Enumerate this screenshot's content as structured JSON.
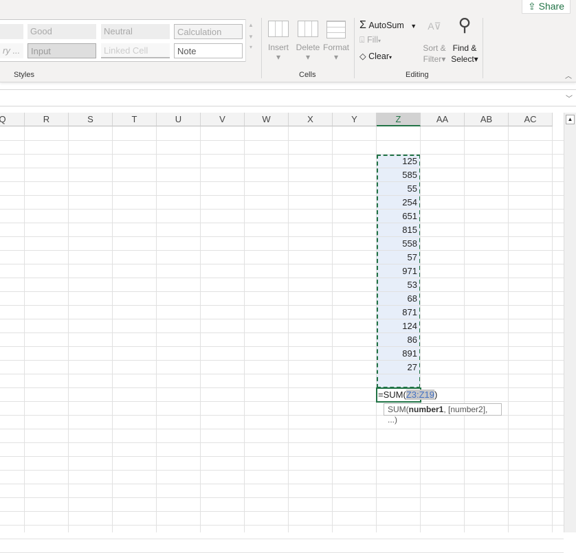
{
  "share_label": "Share",
  "styles": {
    "group_label": "Styles",
    "items": [
      {
        "label": "Good",
        "bg": "#ededed"
      },
      {
        "label": "Neutral",
        "bg": "#ededed"
      },
      {
        "label": "Calculation",
        "bg": "#f3f3f3"
      },
      {
        "label": "ry ...",
        "bg": "#f7f7f7"
      },
      {
        "label": "Input",
        "bg": "#dedede"
      },
      {
        "label": "Linked Cell",
        "bg": "#f3f3f3"
      },
      {
        "label": "Note",
        "bg": "#f7f7f7"
      }
    ]
  },
  "cells": {
    "group_label": "Cells",
    "insert": "Insert",
    "delete": "Delete",
    "format": "Format"
  },
  "editing": {
    "group_label": "Editing",
    "autosum": "AutoSum",
    "fill": "Fill",
    "clear": "Clear",
    "sort1": "Sort &",
    "sort2": "Filter",
    "find1": "Find &",
    "find2": "Select"
  },
  "columns": [
    "Q",
    "R",
    "S",
    "T",
    "U",
    "V",
    "W",
    "X",
    "Y",
    "Z",
    "AA",
    "AB",
    "AC"
  ],
  "selected_column": "Z",
  "values": [
    "125",
    "585",
    "55",
    "254",
    "651",
    "815",
    "558",
    "57",
    "971",
    "53",
    "68",
    "871",
    "124",
    "86",
    "891",
    "27"
  ],
  "formula": {
    "prefix": "=SUM(",
    "ref": "Z3:Z19",
    "suffix": ")"
  },
  "tooltip": {
    "fn": "SUM(",
    "bold": "number1",
    "rest": ", [number2], ...)"
  },
  "accent": "#217346"
}
